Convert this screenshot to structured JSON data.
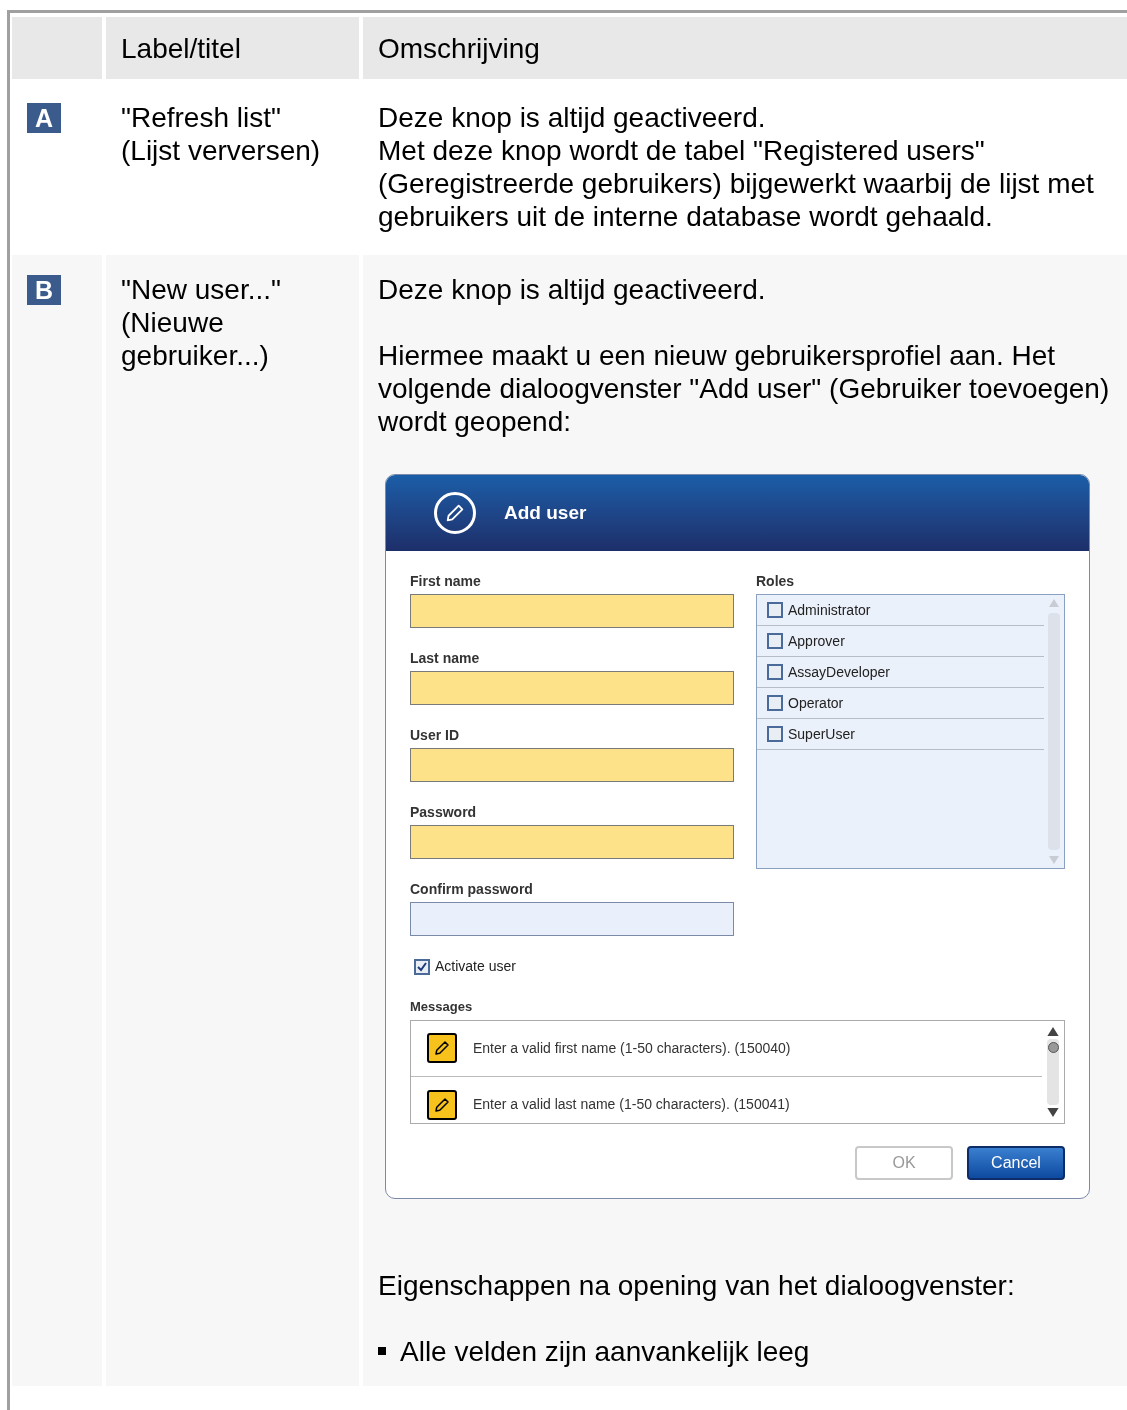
{
  "table": {
    "columns": [
      {
        "label": "Label/titel"
      },
      {
        "label": "Omschrijving"
      }
    ],
    "rows": [
      {
        "marker": "A",
        "label": [
          "\"Refresh list\"",
          "(Lijst verversen)"
        ],
        "description": [
          {
            "kind": "line",
            "text": "Deze knop is altijd geactiveerd."
          },
          {
            "kind": "line",
            "text": "Met deze knop wordt de tabel \"Registered users\" (Geregistreerde gebruikers) bijgewerkt waarbij de lijst met gebruikers uit de interne database wordt gehaald."
          }
        ]
      },
      {
        "marker": "B",
        "label": [
          "\"New user...\"",
          "(Nieuwe gebruiker...)"
        ],
        "description": [
          {
            "kind": "paragraph",
            "text": "Deze knop is altijd geactiveerd."
          },
          {
            "kind": "line",
            "text": "Hiermee maakt u een nieuw gebruikersprofiel aan. Het volgende dialoogvenster \"Add user\" (Gebruiker toevoegen) wordt geopend:"
          },
          {
            "kind": "dialog"
          },
          {
            "kind": "line",
            "text": "Eigenschappen na opening van het dialoogvenster:"
          },
          {
            "kind": "bullet",
            "text": "Alle velden zijn aanvankelijk leeg"
          }
        ]
      }
    ]
  },
  "dialog": {
    "title": "Add user",
    "fields": [
      {
        "label": "First name",
        "required": true
      },
      {
        "label": "Last name",
        "required": true
      },
      {
        "label": "User ID",
        "required": true
      },
      {
        "label": "Password",
        "required": true
      },
      {
        "label": "Confirm password",
        "required": false
      }
    ],
    "roles_label": "Roles",
    "roles": [
      {
        "label": "Administrator",
        "checked": false
      },
      {
        "label": "Approver",
        "checked": false
      },
      {
        "label": "AssayDeveloper",
        "checked": false
      },
      {
        "label": "Operator",
        "checked": false
      },
      {
        "label": "SuperUser",
        "checked": false
      }
    ],
    "activate": {
      "label": "Activate user",
      "checked": true
    },
    "messages_label": "Messages",
    "messages": [
      "Enter a valid first name (1-50 characters). (150040)",
      "Enter a valid last name (1-50 characters). (150041)"
    ],
    "buttons": [
      {
        "label": "OK",
        "disabled": true
      },
      {
        "label": "Cancel",
        "disabled": false
      }
    ]
  }
}
